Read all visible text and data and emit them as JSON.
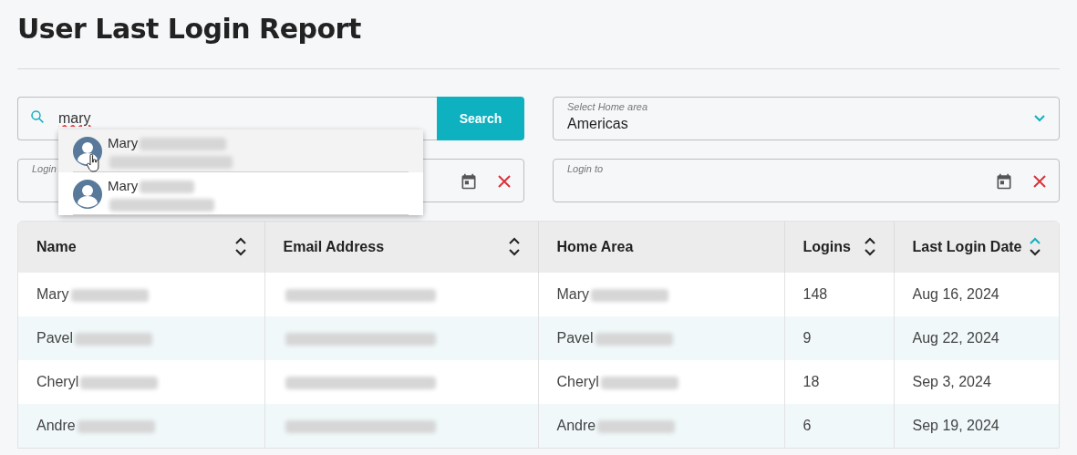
{
  "title": "User Last Login Report",
  "search": {
    "value": "mary",
    "button": "Search",
    "suggestions": [
      {
        "name": "Mary",
        "selected": true
      },
      {
        "name": "Mary",
        "selected": false
      }
    ]
  },
  "home_area": {
    "label": "Select Home area",
    "value": "Americas"
  },
  "login_from": {
    "label": "Login"
  },
  "login_to": {
    "label": "Login to"
  },
  "table": {
    "columns": [
      {
        "label": "Name",
        "sorted": false
      },
      {
        "label": "Email Address",
        "sorted": false
      },
      {
        "label": "Home Area"
      },
      {
        "label": "Logins",
        "sorted": false
      },
      {
        "label": "Last Login Date",
        "sorted": true
      }
    ],
    "rows": [
      {
        "name": "Mary",
        "home_area": "Mary",
        "logins": "148",
        "last_login": "Aug 16, 2024"
      },
      {
        "name": "Pavel",
        "home_area": "Pavel",
        "logins": "9",
        "last_login": "Aug 22, 2024"
      },
      {
        "name": "Cheryl",
        "home_area": "Cheryl",
        "logins": "18",
        "last_login": "Sep 3, 2024"
      },
      {
        "name": "Andre",
        "home_area": "Andre",
        "logins": "6",
        "last_login": "Sep 19, 2024"
      }
    ]
  }
}
